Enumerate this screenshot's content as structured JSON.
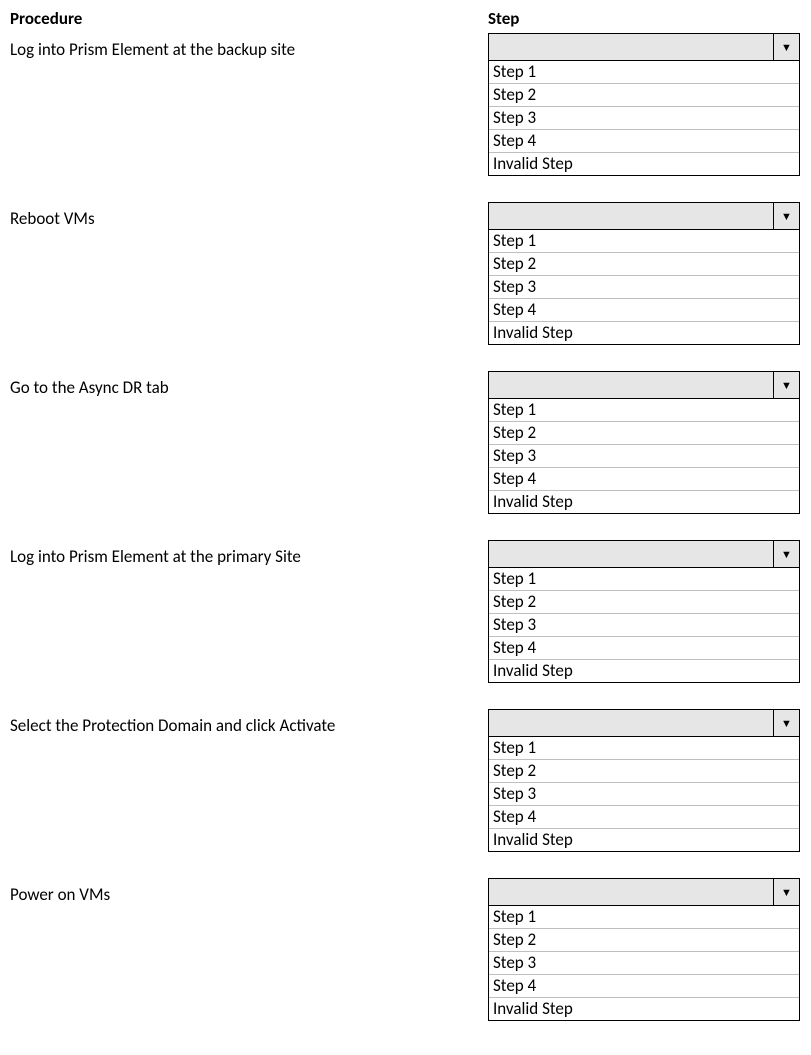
{
  "headers": {
    "procedure": "Procedure",
    "step": "Step"
  },
  "options": [
    "Step 1",
    "Step 2",
    "Step 3",
    "Step 4",
    "Invalid Step"
  ],
  "rows": [
    {
      "label": "Log into Prism Element at the backup site",
      "selected": ""
    },
    {
      "label": "Reboot VMs",
      "selected": ""
    },
    {
      "label": "Go to the Async DR tab",
      "selected": ""
    },
    {
      "label": "Log into Prism Element at the primary Site",
      "selected": ""
    },
    {
      "label": "Select the Protection Domain and click Activate",
      "selected": ""
    },
    {
      "label": "Power on VMs",
      "selected": ""
    }
  ]
}
